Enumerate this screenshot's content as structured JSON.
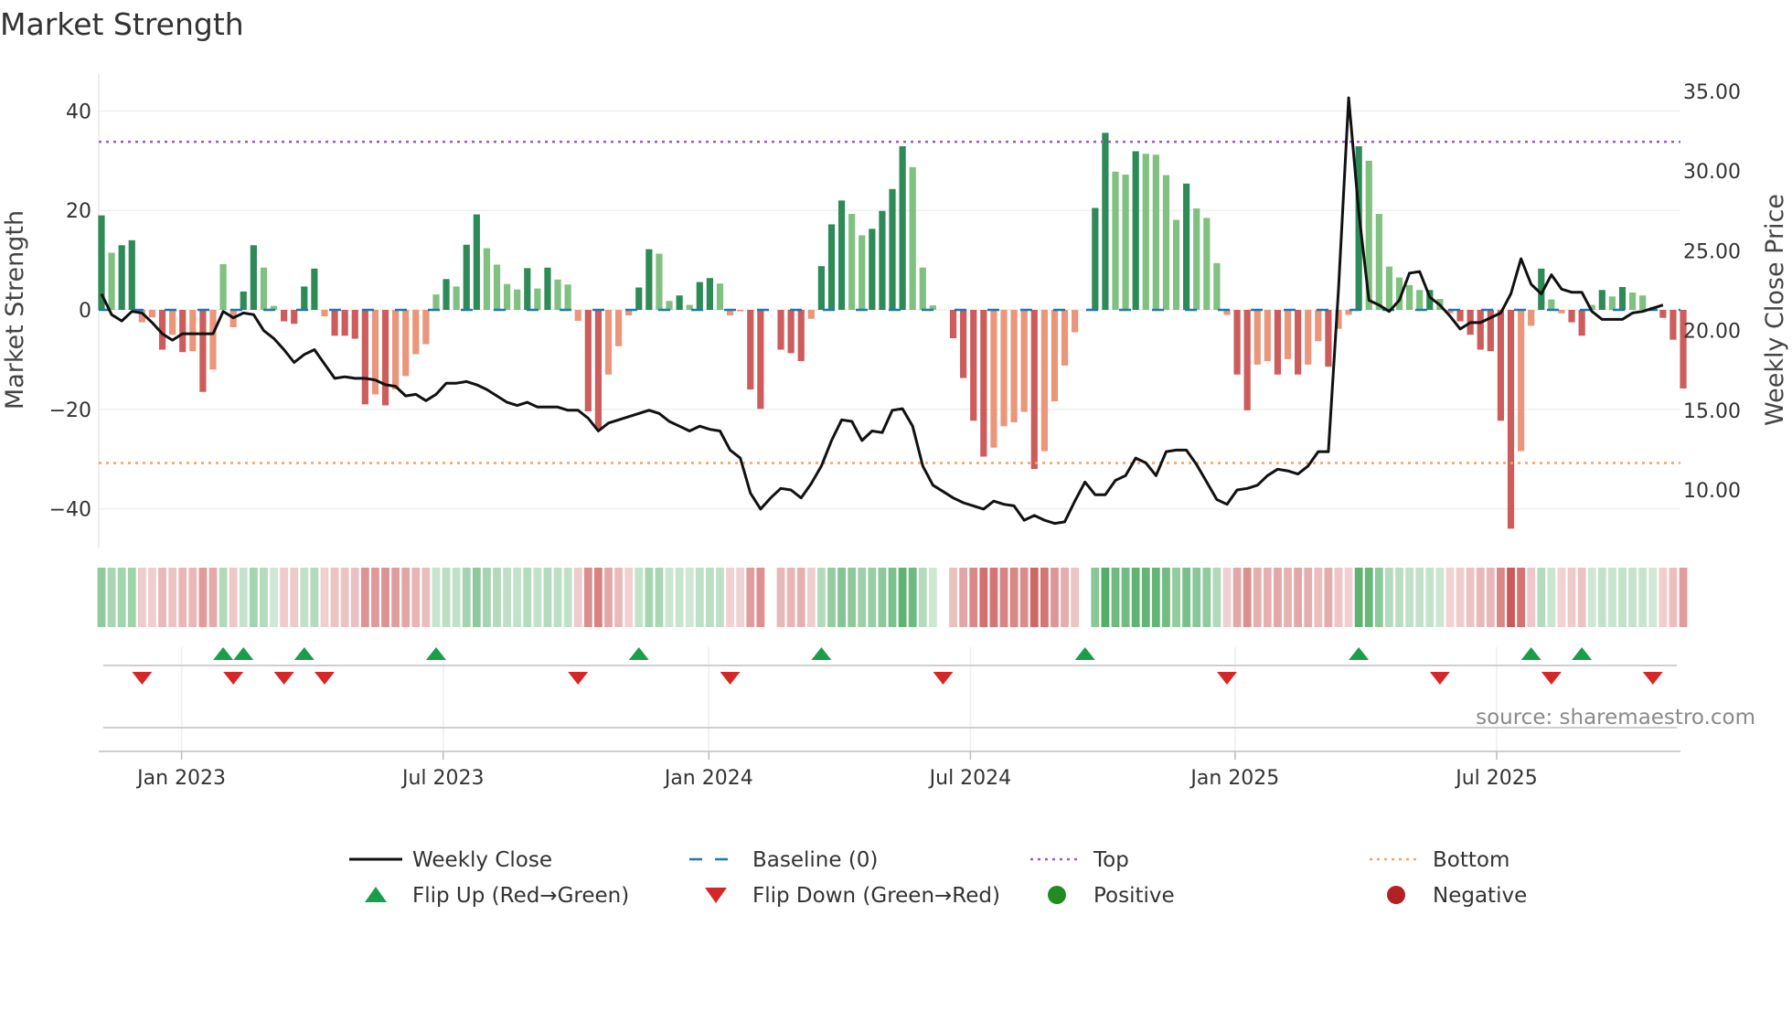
{
  "chart_data": {
    "type": "bar",
    "title": "Market Strength",
    "ylabel": "Market Strength",
    "y2label": "Weekly Close Price",
    "ylim": [
      -48,
      47
    ],
    "y2lim": [
      6.7,
      35.5
    ],
    "yticks": [
      40,
      20,
      0,
      -20,
      -40
    ],
    "yticklabels": [
      "40",
      "20",
      "0",
      "−20",
      "−40"
    ],
    "y2ticks": [
      35,
      30,
      25,
      20,
      15,
      10
    ],
    "y2ticklabels": [
      "35.00",
      "30.00",
      "25.00",
      "20.00",
      "15.00",
      "10.00"
    ],
    "x_unit": "week index",
    "xticks": [
      7.9,
      33.7,
      59.9,
      85.7,
      111.8,
      137.6
    ],
    "xticklabels": [
      "Jan 2023",
      "Jul 2023",
      "Jan 2024",
      "Jul 2024",
      "Jan 2025",
      "Jul 2025"
    ],
    "top_level": 33.8,
    "bottom_level": -30.8,
    "baseline": 0,
    "strength": [
      19,
      11.5,
      13,
      14,
      -2.5,
      -1.5,
      -8,
      -5,
      -8.5,
      -8.3,
      -16.5,
      -12,
      9.2,
      -3.5,
      3.7,
      13,
      8.5,
      0.8,
      -2.3,
      -2.8,
      4.7,
      8.3,
      -1.3,
      -5.2,
      -5.2,
      -5.8,
      -19,
      -17,
      -19.2,
      -16,
      -13.3,
      -8.9,
      -6.9,
      3.1,
      6.2,
      4.7,
      13.1,
      19.2,
      12.4,
      9.1,
      5.2,
      4.1,
      8.4,
      4.3,
      8.5,
      6.1,
      5.1,
      -2.2,
      -20.4,
      -24,
      -13,
      -7.3,
      -1.1,
      4.5,
      12.2,
      11.3,
      1.8,
      2.9,
      1,
      5.6,
      6.4,
      5.3,
      -1.1,
      -0.3,
      -16,
      -19.9,
      0,
      -8,
      -8.7,
      -10.3,
      -1.8,
      8.8,
      17.2,
      22,
      19.3,
      15,
      16.3,
      19.9,
      24.3,
      32.9,
      28.7,
      8.5,
      0.9,
      0,
      -5.7,
      -13.7,
      -22.3,
      -29.5,
      -27.7,
      -23.4,
      -22.6,
      -20.5,
      -32,
      -28.4,
      -18.4,
      -11.2,
      -4.5,
      0,
      20.5,
      35.6,
      27.8,
      27.2,
      31.9,
      31.4,
      31.2,
      27.1,
      18.1,
      25.4,
      20.4,
      18.5,
      9.4,
      -1,
      -13,
      -20.2,
      -11,
      -10.3,
      -13,
      -9.9,
      -13,
      -11,
      -6.3,
      -11.4,
      -3.8,
      -1,
      32.9,
      30,
      19.3,
      8.7,
      6.5,
      5,
      4,
      4,
      2.2,
      -0.7,
      -2.3,
      -5,
      -8,
      -8.3,
      -22.3,
      -44,
      -28.4,
      -3.2,
      8.3,
      2.1,
      -0.7,
      -2.5,
      -5.2,
      1,
      4,
      2.7,
      4.6,
      3.5,
      2.9,
      0.6,
      -1.6,
      -6,
      -15.8
    ],
    "weekly_close": [
      22.3,
      21.0,
      20.6,
      21.2,
      21.1,
      20.5,
      19.8,
      19.4,
      19.8,
      19.8,
      19.8,
      19.8,
      21.2,
      20.8,
      21.1,
      21.0,
      20.0,
      19.5,
      18.8,
      18.0,
      18.5,
      18.8,
      17.9,
      17.0,
      17.1,
      17.0,
      17.0,
      16.9,
      16.6,
      16.5,
      15.9,
      16.0,
      15.6,
      16.0,
      16.7,
      16.7,
      16.8,
      16.6,
      16.3,
      15.9,
      15.5,
      15.3,
      15.5,
      15.2,
      15.2,
      15.2,
      15.0,
      15.0,
      14.5,
      13.7,
      14.2,
      14.4,
      14.6,
      14.8,
      15.0,
      14.8,
      14.3,
      14.0,
      13.7,
      14.0,
      13.8,
      13.7,
      12.5,
      12.0,
      9.8,
      8.8,
      9.5,
      10.1,
      10.0,
      9.5,
      10.4,
      11.5,
      13.1,
      14.4,
      14.3,
      13.1,
      13.7,
      13.6,
      15.0,
      15.1,
      14.0,
      11.5,
      10.3,
      9.9,
      9.5,
      9.2,
      9.0,
      8.8,
      9.3,
      9.1,
      9.0,
      8.1,
      8.4,
      8.1,
      7.9,
      8.0,
      9.3,
      10.5,
      9.7,
      9.7,
      10.6,
      10.9,
      12.0,
      11.7,
      10.9,
      12.4,
      12.5,
      12.5,
      11.6,
      10.5,
      9.4,
      9.1,
      10.0,
      10.1,
      10.3,
      10.9,
      11.3,
      11.2,
      11.0,
      11.5,
      12.4,
      12.4,
      22.6,
      34.6,
      27.4,
      21.9,
      21.6,
      21.2,
      21.9,
      23.6,
      23.7,
      22.1,
      21.6,
      20.9,
      20.1,
      20.5,
      20.5,
      20.8,
      21.1,
      22.3,
      24.5,
      22.9,
      22.3,
      23.5,
      22.6,
      22.4,
      22.4,
      21.2,
      20.7,
      20.7,
      20.7,
      21.1,
      21.2,
      21.4,
      21.6
    ],
    "flip_up_weeks": [
      12,
      14,
      20,
      33,
      53,
      71,
      97,
      124,
      141,
      146
    ],
    "flip_down_weeks": [
      4,
      13,
      18,
      22,
      47,
      62,
      83,
      111,
      132,
      143,
      153
    ],
    "colors": {
      "pos_strong": "#2e8b57",
      "pos_weak": "#80c080",
      "neg_strong": "#cd5c5c",
      "neg_weak": "#e9967a",
      "close": "#111111",
      "baseline": "#1f77b4",
      "top": "#9b59d0",
      "bottom": "#f4a460",
      "flip_up": "#1a9e4a",
      "flip_down": "#d62728",
      "positive": "#228b22",
      "negative": "#b22222"
    },
    "legend": {
      "placement": "bottom-center",
      "items": [
        {
          "label": "Weekly Close",
          "icon": "solid-line"
        },
        {
          "label": "Baseline (0)",
          "icon": "dashed-line"
        },
        {
          "label": "Top",
          "icon": "dotted-line"
        },
        {
          "label": "Bottom",
          "icon": "dotted-line"
        },
        {
          "label": "Flip Up (Red→Green)",
          "icon": "triangle-up"
        },
        {
          "label": "Flip Down (Green→Red)",
          "icon": "triangle-down"
        },
        {
          "label": "Positive",
          "icon": "circle"
        },
        {
          "label": "Negative",
          "icon": "circle"
        }
      ]
    },
    "source": "source: sharemaestro.com"
  }
}
